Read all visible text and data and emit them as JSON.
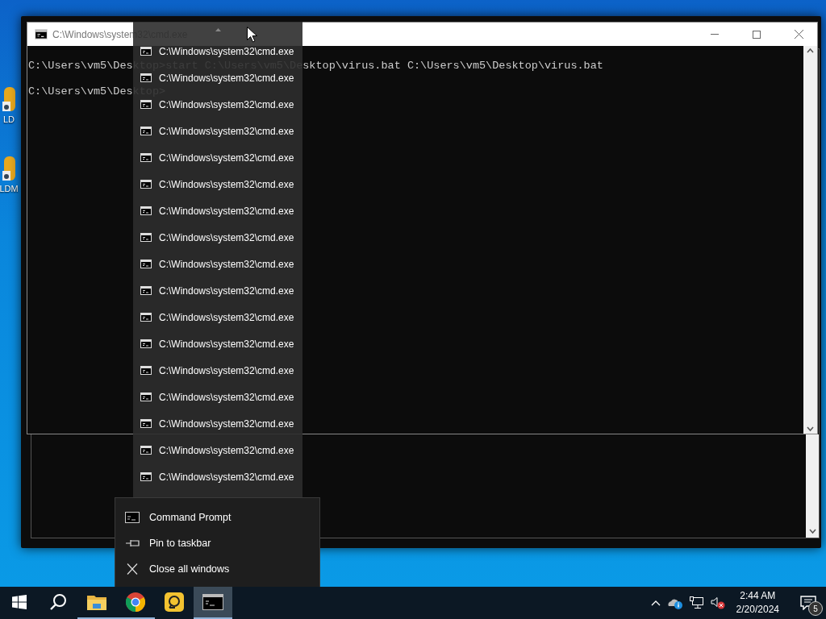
{
  "desktop_icons": [
    {
      "label": "LD"
    },
    {
      "label": "LDM"
    }
  ],
  "window": {
    "title": "C:\\Windows\\system32\\cmd.exe",
    "console_lines": [
      "C:\\Users\\vm5\\Desktop>start C:\\Users\\vm5\\Desktop\\virus.bat C:\\Users\\vm5\\Desktop\\virus.bat",
      "C:\\Users\\vm5\\Desktop>"
    ]
  },
  "window_list": {
    "items": [
      {
        "title": "C:\\Windows\\system32\\cmd.exe"
      },
      {
        "title": "C:\\Windows\\system32\\cmd.exe"
      },
      {
        "title": "C:\\Windows\\system32\\cmd.exe"
      },
      {
        "title": "C:\\Windows\\system32\\cmd.exe"
      },
      {
        "title": "C:\\Windows\\system32\\cmd.exe"
      },
      {
        "title": "C:\\Windows\\system32\\cmd.exe"
      },
      {
        "title": "C:\\Windows\\system32\\cmd.exe"
      },
      {
        "title": "C:\\Windows\\system32\\cmd.exe"
      },
      {
        "title": "C:\\Windows\\system32\\cmd.exe"
      },
      {
        "title": "C:\\Windows\\system32\\cmd.exe"
      },
      {
        "title": "C:\\Windows\\system32\\cmd.exe"
      },
      {
        "title": "C:\\Windows\\system32\\cmd.exe"
      },
      {
        "title": "C:\\Windows\\system32\\cmd.exe"
      },
      {
        "title": "C:\\Windows\\system32\\cmd.exe"
      },
      {
        "title": "C:\\Windows\\system32\\cmd.exe"
      },
      {
        "title": "C:\\Windows\\system32\\cmd.exe"
      },
      {
        "title": "C:\\Windows\\system32\\cmd.exe"
      }
    ]
  },
  "jump_menu": {
    "items": [
      {
        "kind": "app",
        "label": "Command Prompt"
      },
      {
        "kind": "pin",
        "label": "Pin to taskbar"
      },
      {
        "kind": "close",
        "label": "Close all windows"
      }
    ]
  },
  "taskbar": {
    "apps": [
      {
        "kind": "explorer",
        "running": true,
        "active": false
      },
      {
        "kind": "chrome",
        "running": true,
        "active": false
      },
      {
        "kind": "remote",
        "running": false,
        "active": false
      },
      {
        "kind": "cmd",
        "running": true,
        "active": true
      }
    ],
    "time": "2:44 AM",
    "date": "2/20/2024",
    "notification_count": "5"
  }
}
